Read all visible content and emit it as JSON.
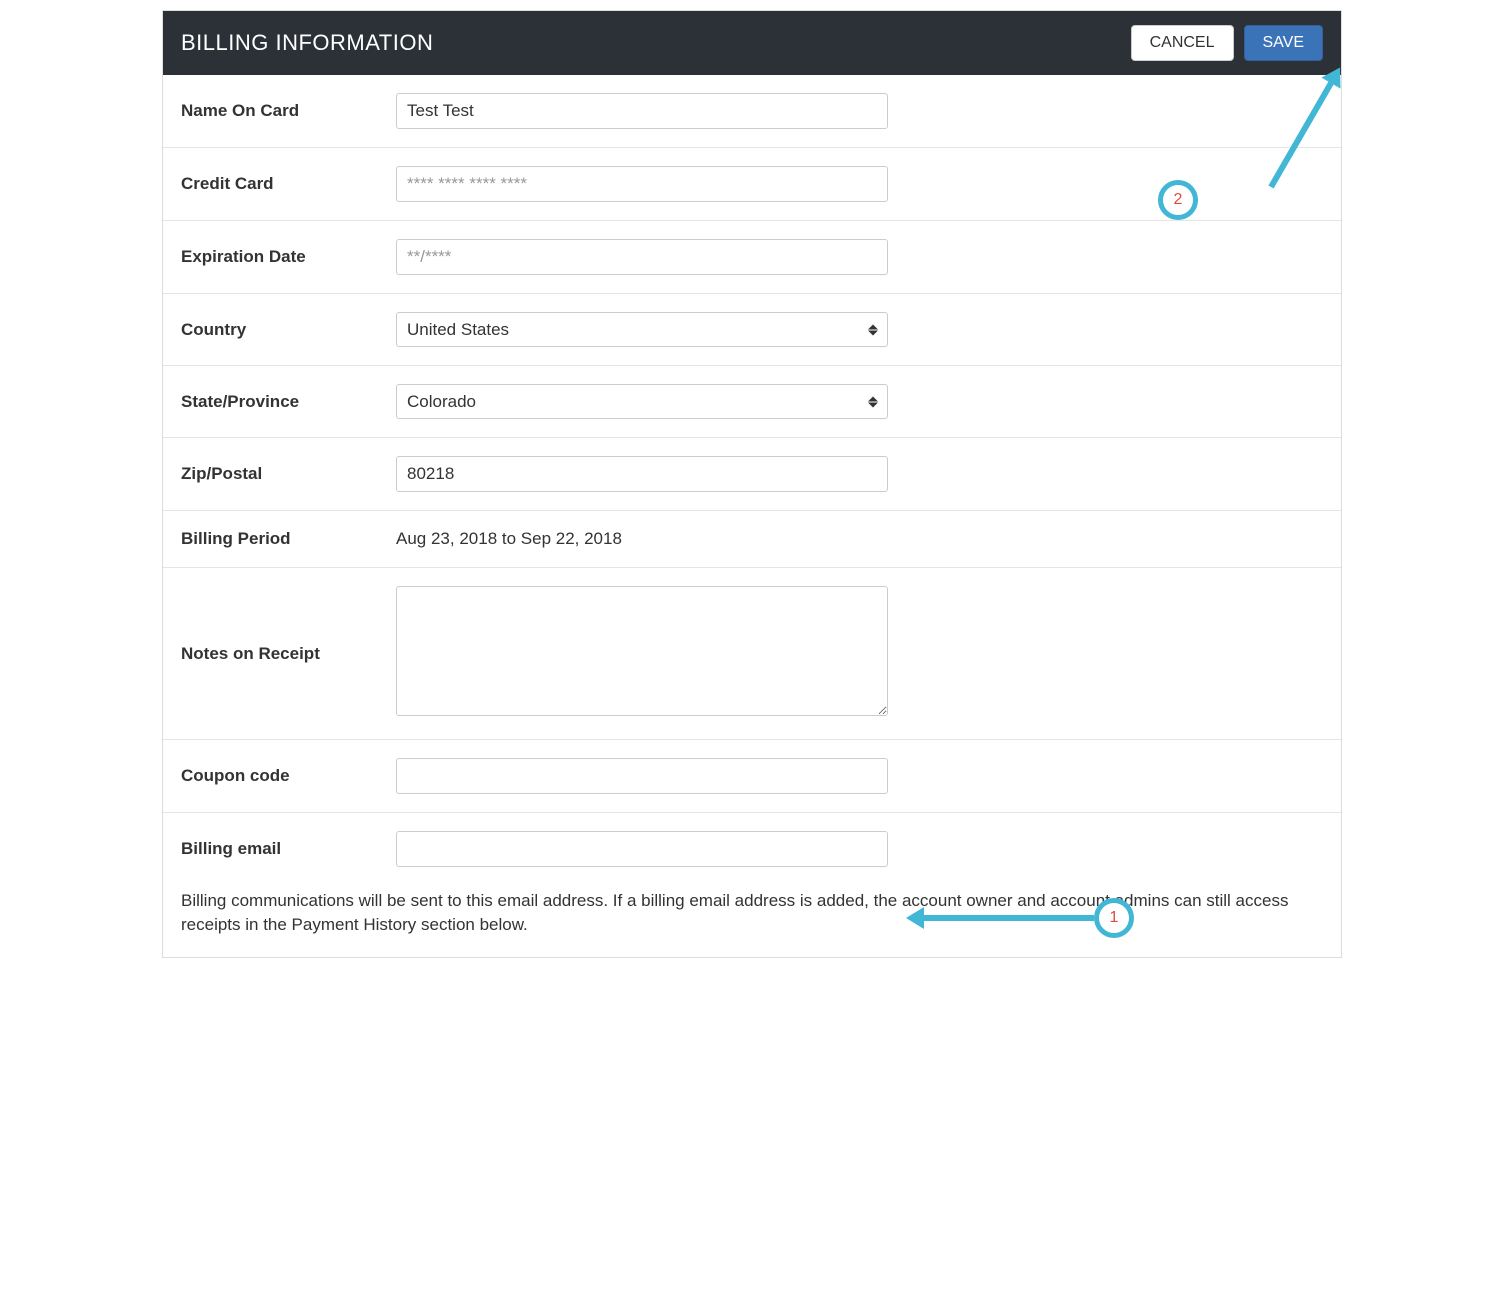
{
  "header": {
    "title": "BILLING INFORMATION",
    "cancel_label": "CANCEL",
    "save_label": "SAVE"
  },
  "fields": {
    "name_on_card": {
      "label": "Name On Card",
      "value": "Test Test"
    },
    "credit_card": {
      "label": "Credit Card",
      "value": "",
      "placeholder": "**** **** **** ****"
    },
    "expiration": {
      "label": "Expiration Date",
      "value": "",
      "placeholder": "**/****"
    },
    "country": {
      "label": "Country",
      "value": "United States"
    },
    "state": {
      "label": "State/Province",
      "value": "Colorado"
    },
    "zip": {
      "label": "Zip/Postal",
      "value": "80218"
    },
    "billing_period": {
      "label": "Billing Period",
      "value": "Aug 23, 2018 to Sep 22, 2018"
    },
    "notes": {
      "label": "Notes on Receipt",
      "value": ""
    },
    "coupon": {
      "label": "Coupon code",
      "value": ""
    },
    "billing_email": {
      "label": "Billing email",
      "value": ""
    }
  },
  "help_text": "Billing communications will be sent to this email address. If a billing email address is added, the account owner and account admins can still access receipts in the Payment History section below.",
  "annotations": {
    "step1": "1",
    "step2": "2"
  }
}
